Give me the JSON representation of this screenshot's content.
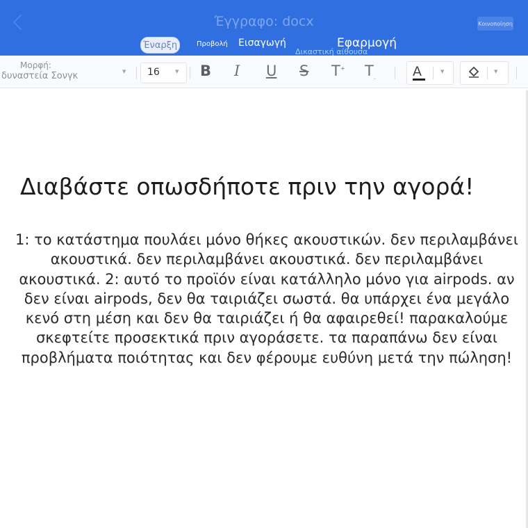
{
  "window": {
    "title": "Έγγραφο: docx",
    "share_label": "Κοινοποίηση"
  },
  "tabs": [
    {
      "label": "Έναρξη",
      "active": true
    },
    {
      "label": "Προβολή"
    },
    {
      "label": "Εισαγωγή"
    },
    {
      "label": "Δικαστική αίθουσα"
    },
    {
      "label": "Εφαρμογή"
    }
  ],
  "toolbar": {
    "font_label": "Μορφή:",
    "font_value": "δυναστεία Σονγκ",
    "font_size": "16",
    "bold": "B",
    "italic": "I",
    "underline": "U",
    "strikethrough": "S",
    "superscript": "T",
    "subscript": "T",
    "font_color": "A"
  },
  "document": {
    "heading": "Διαβάστε οπωσδήποτε πριν την αγορά!",
    "body_lines": [
      "1: το κατάστημα πουλάει μόνο θήκες ακουστικών. δεν περιλαμβάνει",
      "ακουστικά. δεν περιλαμβάνει ακουστικά. δεν περιλαμβάνει",
      "ακουστικά. 2: αυτό το προϊόν είναι κατάλληλο μόνο για airpods. αν",
      "δεν είναι airpods, δεν θα ταιριάζει σωστά. θα υπάρχει ένα μεγάλο",
      "κενό στη μέση και δεν θα ταιριάζει ή θα αφαιρεθεί! παρακαλούμε",
      "σκεφτείτε προσεκτικά πριν αγοράσετε. τα παραπάνω δεν είναι",
      "προβλήματα ποιότητας και δεν φέρουμε ευθύνη μετά την πώληση!"
    ]
  },
  "colors": {
    "header": "#2f6fe0",
    "toolbar": "#fafbfc",
    "text": "#1c1c1c"
  },
  "icons": [
    "back-icon",
    "chevron-down-icon",
    "paint-bucket-icon"
  ]
}
